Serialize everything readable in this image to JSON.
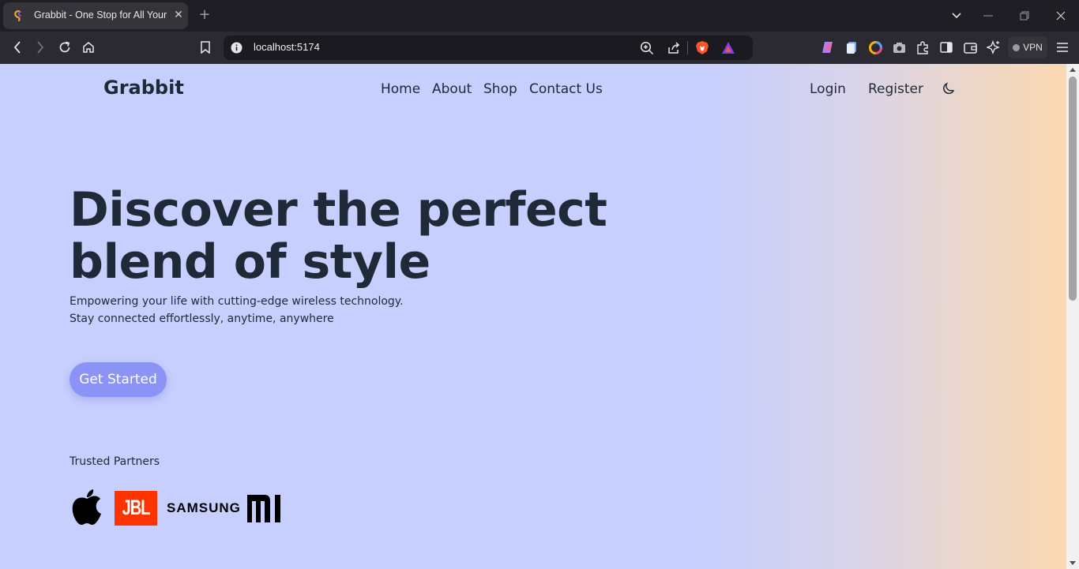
{
  "browser": {
    "tab_title": "Grabbit - One Stop for All Your",
    "tab_close": "✕",
    "new_tab": "+",
    "url": "localhost:5174",
    "vpn_label": "VPN"
  },
  "site": {
    "brand": "Grabbit",
    "nav": [
      "Home",
      "About",
      "Shop",
      "Contact Us"
    ],
    "auth": {
      "login": "Login",
      "register": "Register"
    },
    "hero": {
      "title_line1": "Discover the perfect",
      "title_line2": "blend of style",
      "subtitle_line1": "Empowering your life with cutting-edge wireless technology.",
      "subtitle_line2": "Stay connected effortlessly, anytime, anywhere",
      "cta": "Get Started"
    },
    "partners": {
      "label": "Trusted Partners",
      "logos": [
        {
          "name": "apple-logo",
          "text": ""
        },
        {
          "name": "jbl-logo",
          "text": "JBL"
        },
        {
          "name": "samsung-logo",
          "text": "SAMSUNG"
        },
        {
          "name": "mi-logo",
          "text": "MI"
        }
      ]
    }
  },
  "colors": {
    "page_bg": "#c6cffd",
    "gradient_end": "#fbd8b0",
    "text_dark": "#1f2937",
    "cta_bg": "#8c93f7",
    "jbl_bg": "#ff3300"
  }
}
